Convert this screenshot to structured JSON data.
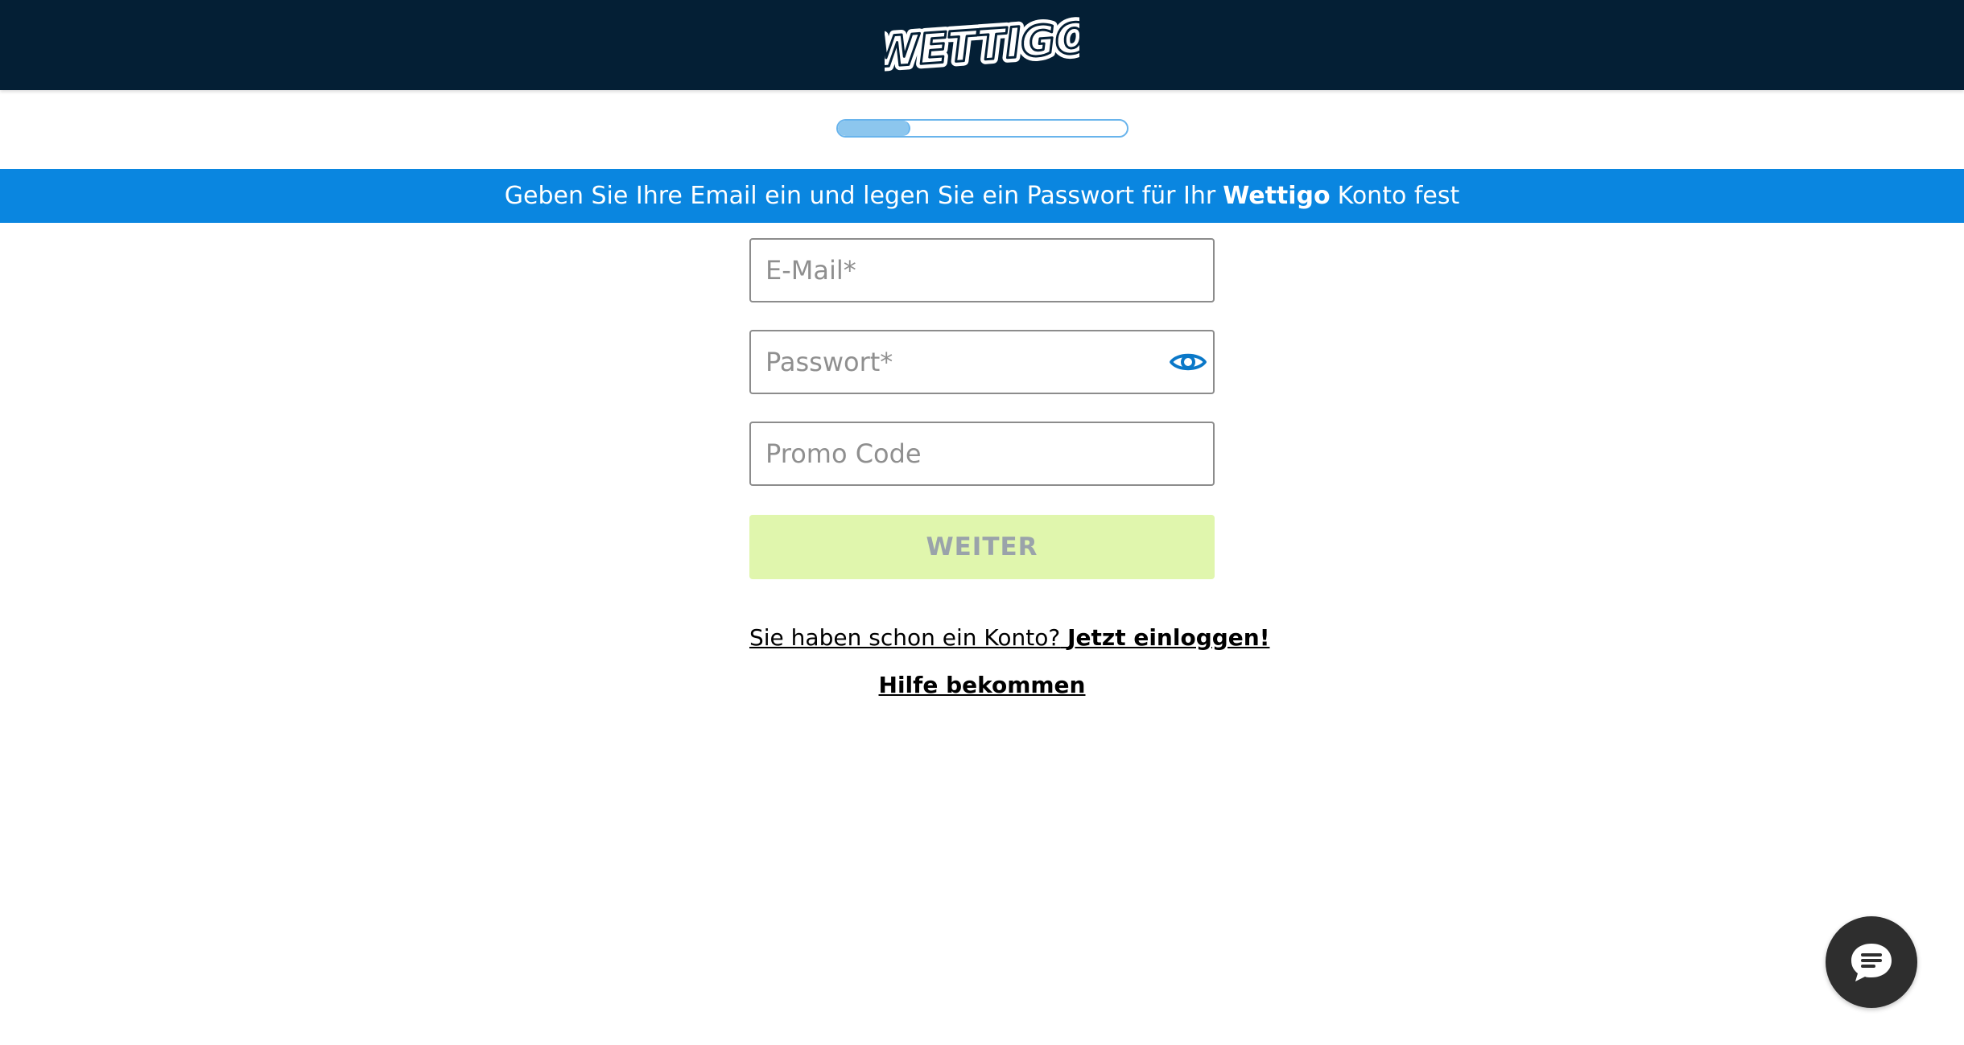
{
  "header": {
    "logo_text": "WETTIGO",
    "logo_icon": "wettigo-logo"
  },
  "progress": {
    "value": 0.25,
    "color": "#8cc6ee"
  },
  "banner": {
    "text_before": "Geben Sie Ihre Email ein und legen Sie ein Passwort für Ihr",
    "brand": "Wettigo",
    "text_after": "Konto fest",
    "background": "#0a86e0"
  },
  "form": {
    "email": {
      "placeholder": "E-Mail*",
      "value": ""
    },
    "password": {
      "placeholder": "Passwort*",
      "value": "",
      "toggle_icon": "eye-icon"
    },
    "promo": {
      "placeholder": "Promo Code",
      "value": ""
    },
    "submit_label": "WEITER"
  },
  "footer_links": {
    "login_prompt": "Sie haben schon ein Konto?",
    "login_link": "Jetzt einloggen!",
    "help_link": "Hilfe bekommen"
  },
  "chat": {
    "icon": "chat-bubble-icon"
  },
  "colors": {
    "header_bg": "#041f35",
    "accent": "#0a86e0",
    "button_disabled_bg": "#e0f6ad",
    "button_disabled_text": "#9aa3aa"
  }
}
